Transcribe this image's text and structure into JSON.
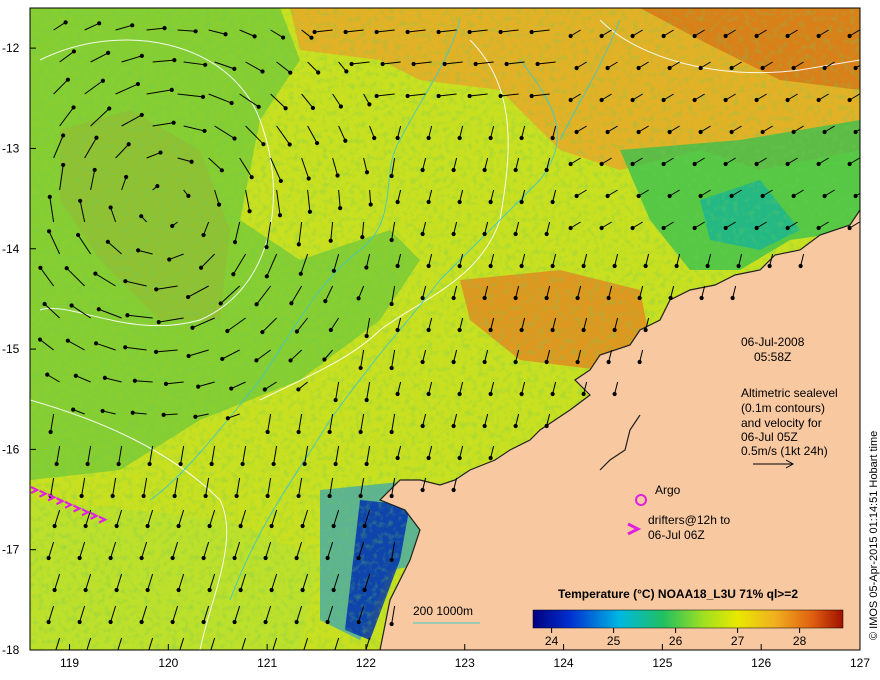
{
  "map": {
    "lon_range": [
      118.6,
      127.0
    ],
    "lat_range": [
      -18.0,
      -11.6
    ],
    "lon_ticks": [
      "119",
      "120",
      "121",
      "122",
      "123",
      "124",
      "125",
      "126",
      "127"
    ],
    "lat_ticks": [
      "-12",
      "-13",
      "-14",
      "-15",
      "-16",
      "-17",
      "-18"
    ],
    "colors": {
      "land": "#f8c8a0",
      "warm": "#e8a020",
      "mid": "#d8d800",
      "cool": "#40c040",
      "cold": "#0040c0",
      "contour_white": "#ffffff",
      "contour_cyan": "#40c8c8",
      "argo": "#e020e0",
      "drifter": "#e020e0",
      "arrow": "#000000"
    }
  },
  "annotations": {
    "date": "06-Jul-2008",
    "time": "05:58Z",
    "alt_lines": [
      "Altimetric sealevel",
      "(0.1m contours)",
      "and velocity for",
      "06-Jul 05Z",
      "0.5m/s (1kt 24h)"
    ],
    "argo_label": "Argo",
    "drifters_lines": [
      "drifters@12h to",
      "06-Jul 06Z"
    ],
    "depth_label": "200  1000m",
    "credit": "© IMOS 05-Apr-2015 01:14:51 Hobart time"
  },
  "legend": {
    "title": "Temperature (°C) NOAA18_L3U 71% ql>=2",
    "ticks": [
      "24",
      "25",
      "26",
      "27",
      "28"
    ],
    "range": [
      23.7,
      28.7
    ]
  }
}
